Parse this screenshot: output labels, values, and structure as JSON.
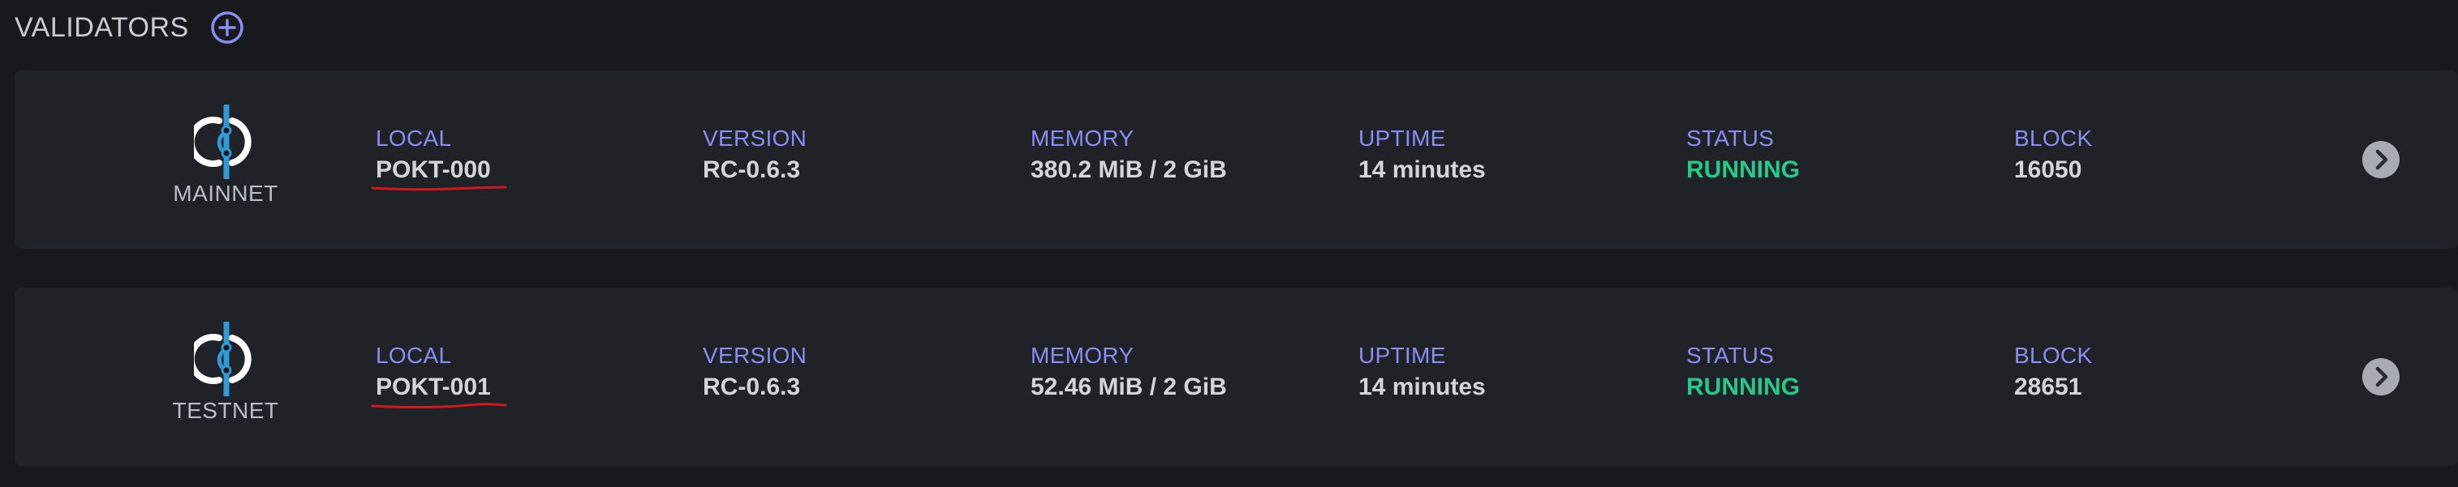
{
  "header": {
    "title": "VALIDATORS",
    "add_icon": "plus-circle-icon"
  },
  "colors": {
    "background": "#17191c",
    "card": "#1f2226",
    "label": "#8b8df2",
    "running": "#26c98a",
    "logo_blue": "#2f9ad6",
    "annotation_red": "#d4191e"
  },
  "validators": [
    {
      "chain": "MAINNET",
      "chain_icon": "pokt-logo-icon",
      "local_label": "LOCAL",
      "local_value": "POKT-000",
      "version_label": "VERSION",
      "version_value": "RC-0.6.3",
      "memory_label": "MEMORY",
      "memory_value": "380.2 MiB / 2 GiB",
      "uptime_label": "UPTIME",
      "uptime_value": "14 minutes",
      "status_label": "STATUS",
      "status_value": "RUNNING",
      "block_label": "BLOCK",
      "block_value": "16050",
      "detail_icon": "chevron-right-circle-icon"
    },
    {
      "chain": "TESTNET",
      "chain_icon": "pokt-logo-icon",
      "local_label": "LOCAL",
      "local_value": "POKT-001",
      "version_label": "VERSION",
      "version_value": "RC-0.6.3",
      "memory_label": "MEMORY",
      "memory_value": "52.46 MiB / 2 GiB",
      "uptime_label": "UPTIME",
      "uptime_value": "14 minutes",
      "status_label": "STATUS",
      "status_value": "RUNNING",
      "block_label": "BLOCK",
      "block_value": "28651",
      "detail_icon": "chevron-right-circle-icon"
    }
  ]
}
